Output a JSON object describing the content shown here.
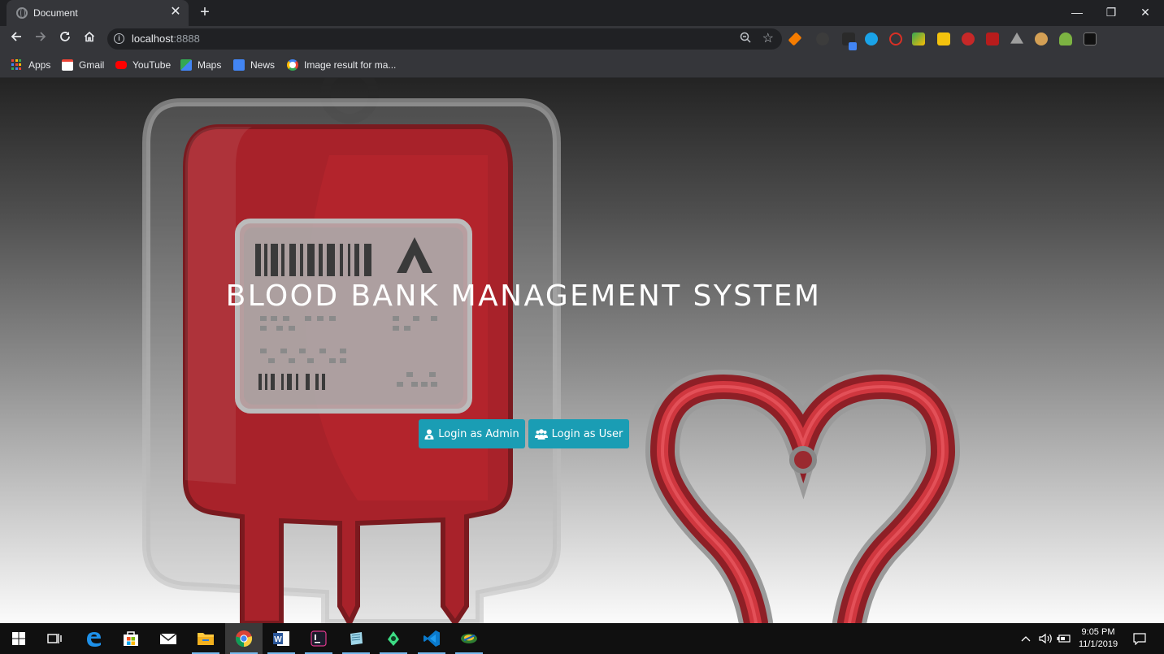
{
  "browser": {
    "tab_title": "Document",
    "tab_close": "✕",
    "new_tab": "+",
    "url_host": "localhost",
    "url_port": ":8888",
    "window_controls": {
      "minimize": "—",
      "restore": "❐",
      "close": "✕"
    }
  },
  "bookmarks": [
    {
      "label": "Apps",
      "icon": "apps-grid-icon"
    },
    {
      "label": "Gmail",
      "icon": "gmail-icon"
    },
    {
      "label": "YouTube",
      "icon": "youtube-icon"
    },
    {
      "label": "Maps",
      "icon": "maps-icon"
    },
    {
      "label": "News",
      "icon": "news-icon"
    },
    {
      "label": "Image result for ma...",
      "icon": "google-icon"
    }
  ],
  "page": {
    "title": "BLOOD BANK MANAGEMENT SYSTEM",
    "admin_button": "Login as Admin",
    "user_button": "Login as User"
  },
  "taskbar": {
    "time": "9:05 PM",
    "date": "11/1/2019"
  },
  "colors": {
    "button": "#1a9db4",
    "blood_red": "#b8242c",
    "chrome_dark": "#202124"
  }
}
